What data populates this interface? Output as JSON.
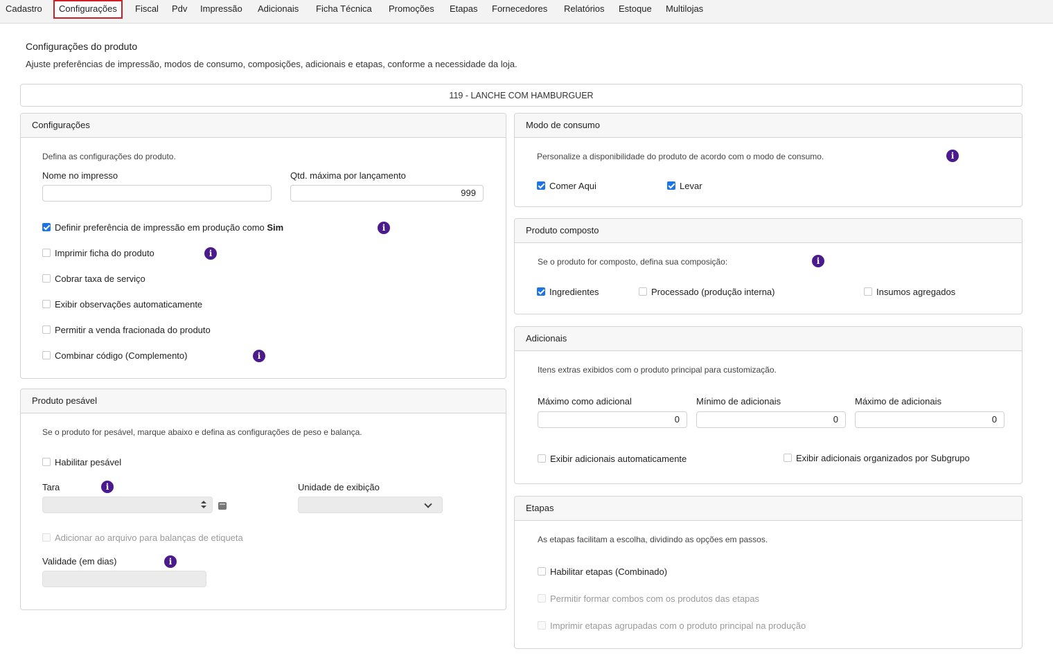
{
  "tabs": [
    {
      "label": "Cadastro"
    },
    {
      "label": "Configurações"
    },
    {
      "label": "Fiscal"
    },
    {
      "label": "Pdv"
    },
    {
      "label": "Impressão"
    },
    {
      "label": "Adicionais"
    },
    {
      "label": "Ficha Técnica"
    },
    {
      "label": "Promoções"
    },
    {
      "label": "Etapas"
    },
    {
      "label": "Fornecedores"
    },
    {
      "label": "Relatórios"
    },
    {
      "label": "Estoque"
    },
    {
      "label": "Multilojas"
    }
  ],
  "active_tab": "Configurações",
  "page": {
    "title": "Configurações do produto",
    "subtitle": "Ajuste preferências de impressão, modos de consumo, composições, adicionais e etapas, conforme a necessidade da loja.",
    "product": "119 - LANCHE COM HAMBURGUER"
  },
  "config": {
    "title": "Configurações",
    "desc": "Defina as configurações do produto.",
    "name_label": "Nome no impresso",
    "name_value": "",
    "qty_label": "Qtd. máxima por lançamento",
    "qty_value": "999",
    "options": [
      {
        "label": "Definir preferência de impressão em produção como ",
        "bold": "Sim",
        "checked": true
      },
      {
        "label": "Imprimir ficha do produto",
        "checked": false
      },
      {
        "label": "Cobrar taxa de serviço",
        "checked": false
      },
      {
        "label": "Exibir observações automaticamente",
        "checked": false
      },
      {
        "label": "Permitir a venda fracionada do produto",
        "checked": false
      },
      {
        "label": "Combinar código (Complemento)",
        "checked": false
      }
    ]
  },
  "pesavel": {
    "title": "Produto pesável",
    "desc": "Se o produto for pesável, marque abaixo e defina as configurações de peso e balança.",
    "enable_label": "Habilitar pesável",
    "enable_checked": false,
    "tara_label": "Tara",
    "unit_label": "Unidade de exibição",
    "label_file": "Adicionar ao arquivo para balanças de etiqueta",
    "validity_label": "Validade (em dias)"
  },
  "consumo": {
    "title": "Modo de consumo",
    "desc": "Personalize a disponibilidade do produto de acordo com o modo de consumo.",
    "options": [
      {
        "label": "Comer Aqui",
        "checked": true
      },
      {
        "label": "Levar",
        "checked": true
      }
    ]
  },
  "composto": {
    "title": "Produto composto",
    "desc": "Se o produto for composto, defina sua composição:",
    "options": [
      {
        "label": "Ingredientes",
        "checked": true
      },
      {
        "label": "Processado (produção interna)",
        "checked": false
      },
      {
        "label": "Insumos agregados",
        "checked": false
      }
    ]
  },
  "adicionais": {
    "title": "Adicionais",
    "desc": "Itens extras exibidos com o produto principal para customização.",
    "fields": [
      {
        "label": "Máximo como adicional",
        "value": "0"
      },
      {
        "label": "Mínimo de adicionais",
        "value": "0"
      },
      {
        "label": "Máximo de adicionais",
        "value": "0"
      }
    ],
    "options": [
      {
        "label": "Exibir adicionais automaticamente",
        "checked": false
      },
      {
        "label": "Exibir adicionais organizados por Subgrupo",
        "checked": false
      }
    ]
  },
  "etapas": {
    "title": "Etapas",
    "desc": "As etapas facilitam a escolha, dividindo as opções em passos.",
    "options": [
      {
        "label": "Habilitar etapas (Combinado)",
        "checked": false
      },
      {
        "label": "Permitir formar combos com os produtos das etapas",
        "checked": false
      },
      {
        "label": "Imprimir etapas agrupadas com o produto principal na produção",
        "checked": false
      }
    ]
  },
  "colors": {
    "accent": "#1d73e8",
    "info": "#4b1a8c",
    "active_tab_border": "#d21f26"
  }
}
